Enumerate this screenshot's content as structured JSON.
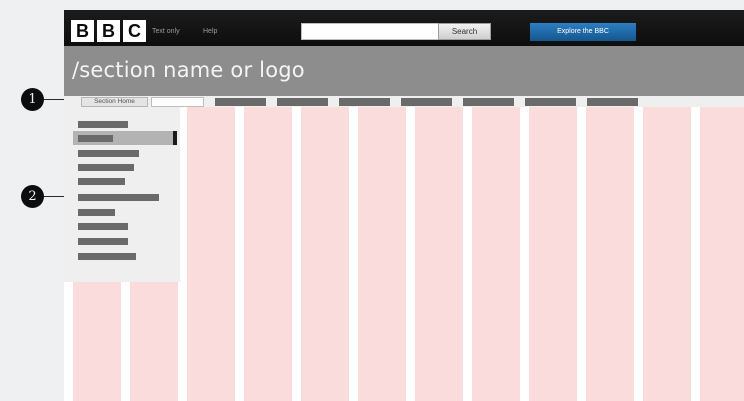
{
  "masthead": {
    "logo_letters": [
      "B",
      "B",
      "C"
    ],
    "text_only_link": "Text only",
    "help_link": "Help",
    "search_placeholder": "",
    "search_button": "Search",
    "explore_button": "Explore the BBC"
  },
  "banner": {
    "section_title": "/section name or logo"
  },
  "nav": {
    "home_label": "Section Home",
    "tab_count": 7
  },
  "callouts": {
    "one": "1",
    "two": "2"
  },
  "colors": {
    "masthead": "#111111",
    "banner": "#8d8d8d",
    "grid_column": "#fbdcdc",
    "placeholder_bar": "#6a6a6a",
    "explore_button": "#1f6aa8"
  },
  "icons": {
    "callout_marker": "numbered-circle"
  }
}
